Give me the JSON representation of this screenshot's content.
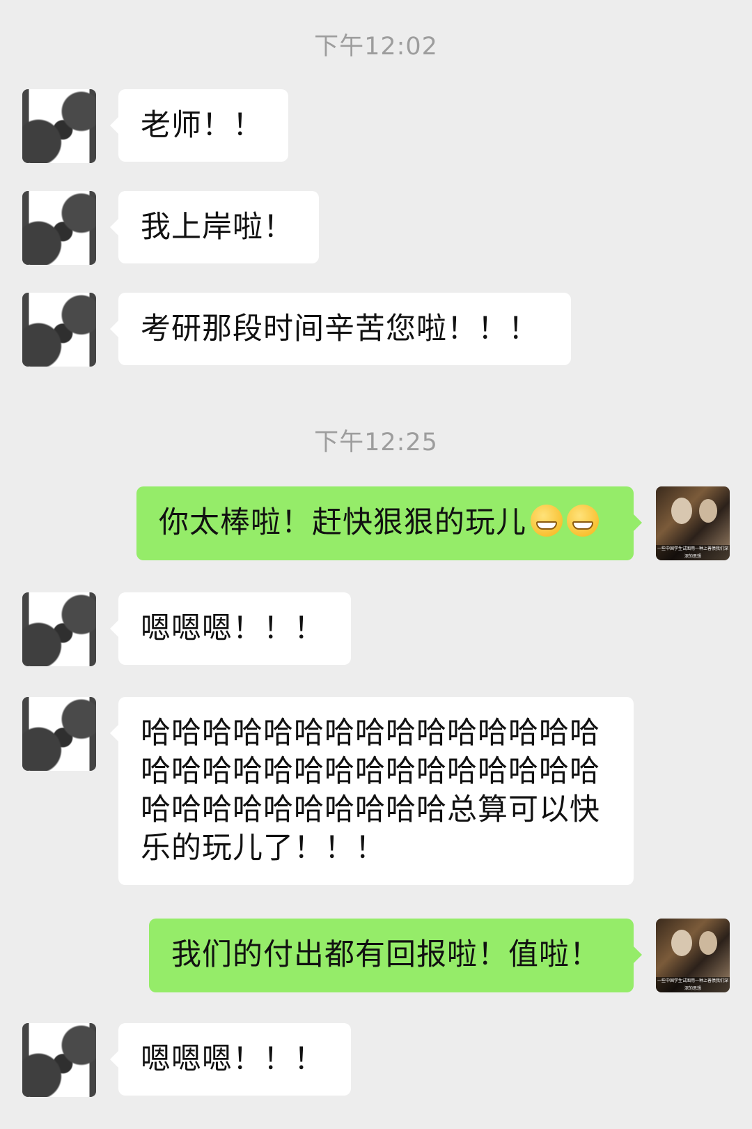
{
  "chat": {
    "timestamps": [
      "下午12:02",
      "下午12:25"
    ],
    "messages": [
      {
        "sender": "other",
        "text": "老师！！"
      },
      {
        "sender": "other",
        "text": "我上岸啦！"
      },
      {
        "sender": "other",
        "text": "考研那段时间辛苦您啦！！！"
      },
      {
        "sender": "me",
        "text": "你太棒啦！赶快狠狠的玩儿",
        "emoji": [
          "grin-emoji",
          "grin-emoji"
        ]
      },
      {
        "sender": "other",
        "text": "嗯嗯嗯！！！"
      },
      {
        "sender": "other",
        "text": "哈哈哈哈哈哈哈哈哈哈哈哈哈哈哈哈哈哈哈哈哈哈哈哈哈哈哈哈哈哈哈哈哈哈哈哈哈哈哈哈总算可以快乐的玩儿了！！！"
      },
      {
        "sender": "me",
        "text": "我们的付出都有回报啦！值啦！"
      },
      {
        "sender": "other",
        "text": "嗯嗯嗯！！！"
      }
    ],
    "my_avatar": {
      "caption": "一些中国学生试图用一种上善债我们深深的思想"
    }
  },
  "colors": {
    "background": "#ededed",
    "incoming_bubble": "#ffffff",
    "outgoing_bubble": "#95ec69",
    "timestamp": "#9d9d9d"
  }
}
